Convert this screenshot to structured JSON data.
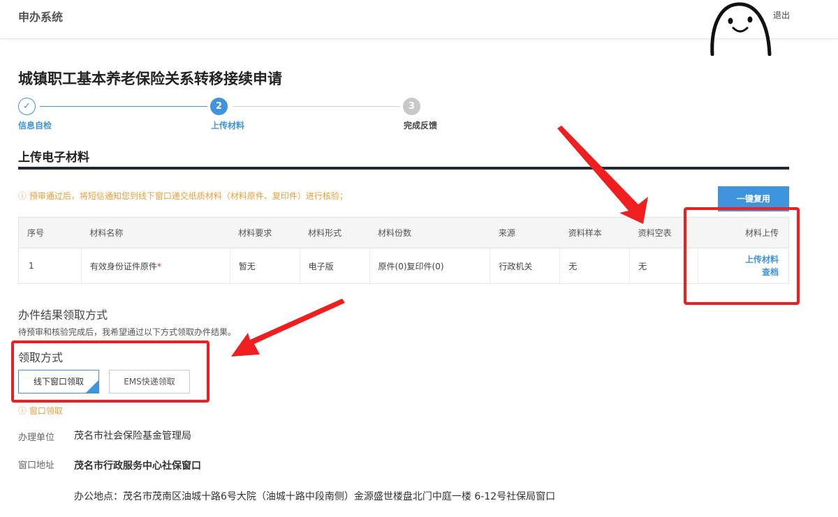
{
  "header": {
    "app_title": "申办系统",
    "logout_label": "退出"
  },
  "page": {
    "title": "城镇职工基本养老保险关系转移接续申请"
  },
  "steps": [
    {
      "number": "✓",
      "label": "信息自检",
      "state": "done"
    },
    {
      "number": "2",
      "label": "上传材料",
      "state": "active"
    },
    {
      "number": "3",
      "label": "完成反馈",
      "state": "pending"
    }
  ],
  "section": {
    "title": "上传电子材料"
  },
  "notice": {
    "icon": "warning-circle-icon",
    "text": "预审通过后，将短信通知您到线下窗口递交纸质材料（材料原件、复印件）进行核验；"
  },
  "toolbar": {
    "reuse_label": "一键复用"
  },
  "table": {
    "headers": [
      "序号",
      "材料名称",
      "材料要求",
      "材料形式",
      "材料份数",
      "来源",
      "资料样本",
      "资料空表",
      "材料上传"
    ],
    "rows": [
      {
        "index": "1",
        "name": "有效身份证件原件",
        "required_mark": "*",
        "requirement": "暂无",
        "form": "电子版",
        "copies": "原件(0)复印件(0)",
        "source": "行政机关",
        "sample": "无",
        "blank_form": "无",
        "upload_label": "上传材料",
        "view_label": "查档"
      }
    ]
  },
  "result": {
    "title": "办件结果领取方式",
    "description": "待预审和核验完成后，我希望通过以下方式领取办件结果。",
    "method_label": "领取方式",
    "options": [
      {
        "label": "线下窗口领取",
        "selected": true
      },
      {
        "label": "EMS快递领取",
        "selected": false
      }
    ],
    "selected_hint": "窗口领取"
  },
  "office": {
    "unit_label": "办理单位",
    "unit_value": "茂名市社会保险基金管理局",
    "address_label": "窗口地址",
    "address_name": "茂名市行政服务中心社保窗口",
    "address_detail": "办公地点：茂名市茂南区油城十路6号大院（油城十路中段南侧）金源盛世楼盘北门中庭一楼 6-12号社保局窗口"
  },
  "colors": {
    "accent": "#3e94dd",
    "warning": "#e8a03b",
    "annotation": "#f01e1e",
    "section_rule": "#1f2a36"
  }
}
